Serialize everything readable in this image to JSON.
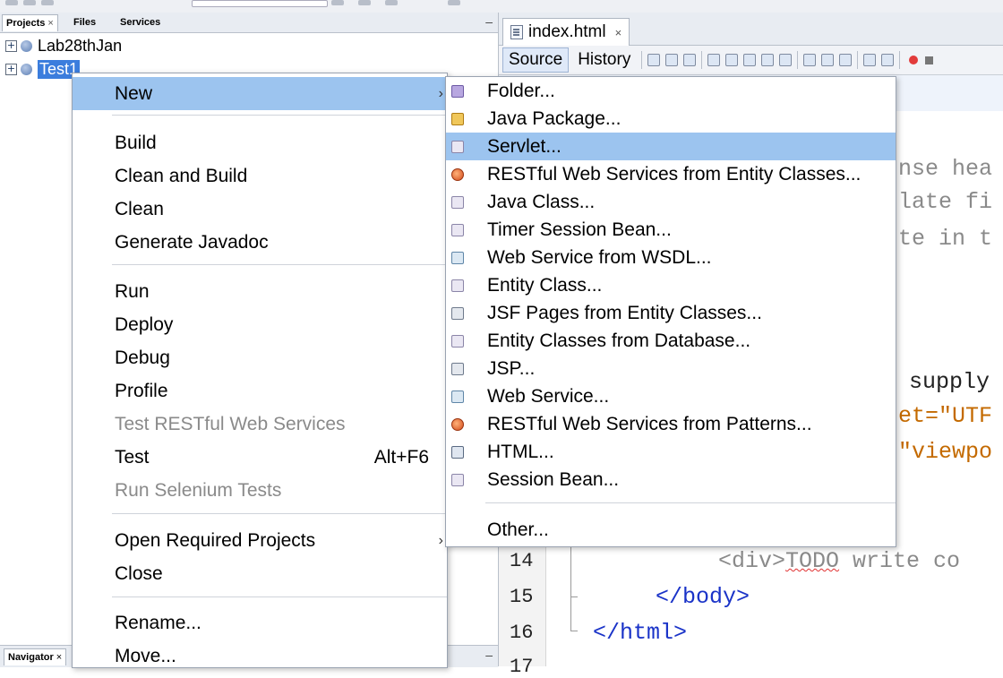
{
  "projects_panel": {
    "tabs": [
      {
        "label": "Projects",
        "close": "×"
      },
      {
        "label": "Files",
        "close": ""
      },
      {
        "label": "Services",
        "close": ""
      }
    ],
    "minimize": "–",
    "tree": [
      {
        "expander": "+",
        "label": "Lab28thJan",
        "selected": false
      },
      {
        "expander": "+",
        "label": "Test1",
        "selected": true
      }
    ],
    "navigator": {
      "label": "Navigator",
      "close": "×",
      "minimize": "–"
    }
  },
  "editor": {
    "tab": {
      "label": "index.html",
      "close": "×"
    },
    "toolbar": {
      "source_label": "Source",
      "history_label": "History"
    },
    "line_numbers": [
      "14",
      "15",
      "16",
      "17"
    ],
    "code_fragments": {
      "l1": "nse hea",
      "l2": "late fi",
      "l3": "te in t",
      "l4": "supply",
      "l5": "et=\"UTF",
      "l6": "\"viewpo",
      "l14_tag": "<div>",
      "l14_todo": "TODO",
      "l14_rest": " write co",
      "l15": "</body>",
      "l16": "</html>"
    }
  },
  "context_menu": {
    "new": {
      "label": "New",
      "arrow": "›"
    },
    "group1": [
      {
        "label": "Build"
      },
      {
        "label": "Clean and Build"
      },
      {
        "label": "Clean"
      },
      {
        "label": "Generate Javadoc"
      }
    ],
    "group2": [
      {
        "label": "Run",
        "disabled": false
      },
      {
        "label": "Deploy",
        "disabled": false
      },
      {
        "label": "Debug",
        "disabled": false
      },
      {
        "label": "Profile",
        "disabled": false
      },
      {
        "label": "Test RESTful Web Services",
        "disabled": true
      },
      {
        "label": "Test",
        "shortcut": "Alt+F6",
        "disabled": false
      },
      {
        "label": "Run Selenium Tests",
        "disabled": true
      }
    ],
    "group3": [
      {
        "label": "Open Required Projects",
        "arrow": "›"
      },
      {
        "label": "Close"
      }
    ],
    "group4": [
      {
        "label": "Rename..."
      },
      {
        "label": "Move..."
      }
    ]
  },
  "new_submenu": {
    "items": [
      {
        "label": "Folder...",
        "icon": "folder-icon"
      },
      {
        "label": "Java Package...",
        "icon": "package-icon"
      },
      {
        "label": "Servlet...",
        "icon": "servlet-icon",
        "highlight": true
      },
      {
        "label": "RESTful Web Services from Entity Classes...",
        "icon": "rest-icon"
      },
      {
        "label": "Java Class...",
        "icon": "class-icon"
      },
      {
        "label": "Timer Session Bean...",
        "icon": "class-icon"
      },
      {
        "label": "Web Service from WSDL...",
        "icon": "webservice-icon"
      },
      {
        "label": "Entity Class...",
        "icon": "class-icon"
      },
      {
        "label": "JSF Pages from Entity Classes...",
        "icon": "jsf-icon"
      },
      {
        "label": "Entity Classes from Database...",
        "icon": "class-icon"
      },
      {
        "label": "JSP...",
        "icon": "jsf-icon"
      },
      {
        "label": "Web Service...",
        "icon": "webservice-icon"
      },
      {
        "label": "RESTful Web Services from Patterns...",
        "icon": "rest-icon"
      },
      {
        "label": "HTML...",
        "icon": "html-icon"
      },
      {
        "label": "Session Bean...",
        "icon": "class-icon"
      }
    ],
    "other": {
      "label": "Other..."
    }
  }
}
